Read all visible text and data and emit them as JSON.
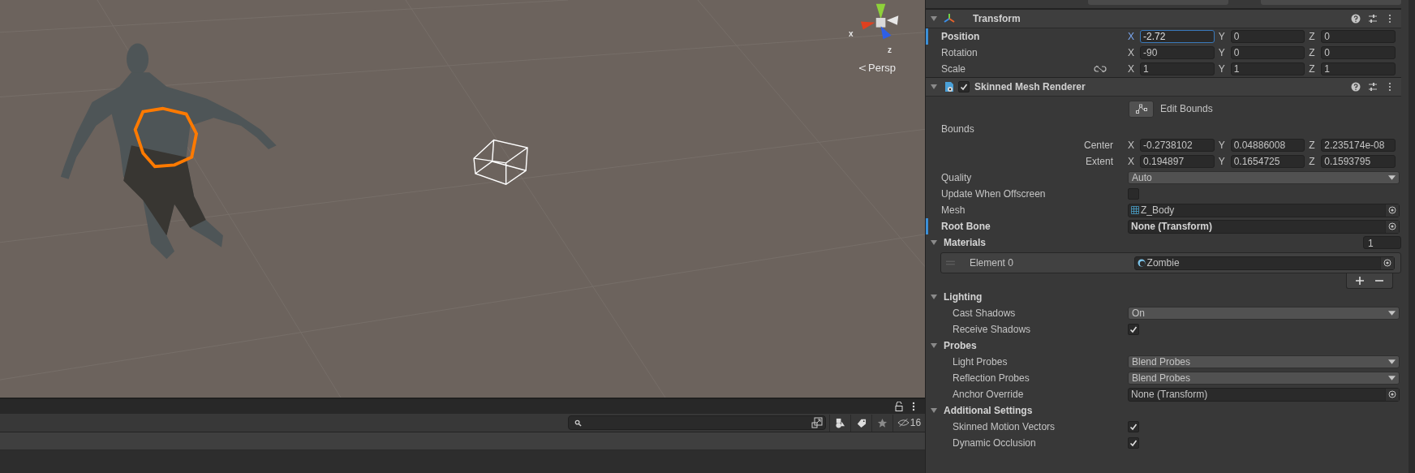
{
  "scene_view": {
    "gizmo": {
      "axis_labels": [
        "x",
        "z"
      ],
      "projection": "Persp"
    }
  },
  "bottom_panel": {
    "hidden_count": "16"
  },
  "inspector": {
    "transform": {
      "title": "Transform",
      "expanded": true,
      "rows": [
        {
          "label": "Position",
          "modified": true,
          "fields": [
            {
              "axis": "X",
              "value": "-2.72",
              "focused": true
            },
            {
              "axis": "Y",
              "value": "0",
              "focused": false
            },
            {
              "axis": "Z",
              "value": "0",
              "focused": false
            }
          ]
        },
        {
          "label": "Rotation",
          "modified": false,
          "fields": [
            {
              "axis": "X",
              "value": "-90",
              "focused": false
            },
            {
              "axis": "Y",
              "value": "0",
              "focused": false
            },
            {
              "axis": "Z",
              "value": "0",
              "focused": false
            }
          ]
        },
        {
          "label": "Scale",
          "modified": false,
          "linked": false,
          "fields": [
            {
              "axis": "X",
              "value": "1",
              "focused": false
            },
            {
              "axis": "Y",
              "value": "1",
              "focused": false
            },
            {
              "axis": "Z",
              "value": "1",
              "focused": false
            }
          ]
        }
      ]
    },
    "skinned_mesh_renderer": {
      "title": "Skinned Mesh Renderer",
      "enabled": true,
      "expanded": true,
      "edit_bounds": "Edit Bounds",
      "bounds_label": "Bounds",
      "bounds": [
        {
          "label": "Center",
          "fields": [
            {
              "axis": "X",
              "value": "-0.2738102"
            },
            {
              "axis": "Y",
              "value": "0.04886008"
            },
            {
              "axis": "Z",
              "value": "2.235174e-08"
            }
          ]
        },
        {
          "label": "Extent",
          "fields": [
            {
              "axis": "X",
              "value": "0.194897"
            },
            {
              "axis": "Y",
              "value": "0.1654725"
            },
            {
              "axis": "Z",
              "value": "0.1593795"
            }
          ]
        }
      ],
      "properties": [
        {
          "kind": "dropdown",
          "label": "Quality",
          "value": "Auto",
          "modified": false
        },
        {
          "kind": "checkbox",
          "label": "Update When Offscreen",
          "checked": false,
          "modified": false
        },
        {
          "kind": "mesh",
          "label": "Mesh",
          "value": "Z_Body",
          "modified": false
        },
        {
          "kind": "object",
          "label": "Root Bone",
          "value": "None (Transform)",
          "modified": true
        }
      ],
      "materials": {
        "label": "Materials",
        "expanded": true,
        "count": "1",
        "elements": [
          {
            "label": "Element 0",
            "value": "Zombie"
          }
        ]
      },
      "sections": [
        {
          "title": "Lighting",
          "expanded": true,
          "properties": [
            {
              "kind": "dropdown",
              "label": "Cast Shadows",
              "value": "On",
              "modified": false
            },
            {
              "kind": "checkbox",
              "label": "Receive Shadows",
              "checked": true,
              "modified": false
            }
          ]
        },
        {
          "title": "Probes",
          "expanded": true,
          "properties": [
            {
              "kind": "dropdown",
              "label": "Light Probes",
              "value": "Blend Probes",
              "modified": false
            },
            {
              "kind": "dropdown",
              "label": "Reflection Probes",
              "value": "Blend Probes",
              "modified": false
            },
            {
              "kind": "object",
              "label": "Anchor Override",
              "value": "None (Transform)",
              "modified": false
            }
          ]
        },
        {
          "title": "Additional Settings",
          "expanded": true,
          "properties": [
            {
              "kind": "checkbox",
              "label": "Skinned Motion Vectors",
              "checked": true,
              "modified": false
            },
            {
              "kind": "checkbox",
              "label": "Dynamic Occlusion",
              "checked": true,
              "modified": false
            }
          ]
        }
      ]
    }
  }
}
